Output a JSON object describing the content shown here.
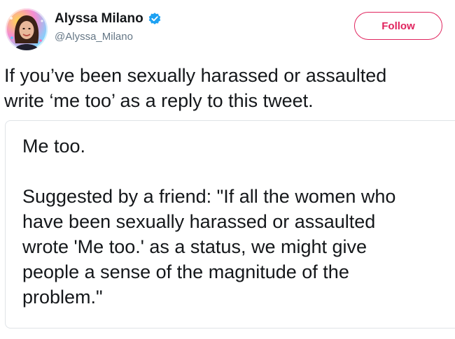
{
  "author": {
    "display_name": "Alyssa Milano",
    "handle": "@Alyssa_Milano",
    "verified_icon": "verified-badge-icon",
    "avatar": "profile-photo"
  },
  "follow_button": {
    "label": "Follow",
    "color": "#e0245e"
  },
  "tweet": {
    "text": "If you’ve been sexually harassed or assaulted\nwrite ‘me too’ as a reply to this tweet."
  },
  "quoted_image": {
    "line1": "Me too.",
    "body": "Suggested by a friend: \"If all the women who\nhave been sexually harassed or assaulted\nwrote 'Me too.' as a status, we might give\npeople a sense of the magnitude of the\nproblem.\""
  },
  "colors": {
    "accent": "#e0245e",
    "verified": "#1da1f2",
    "secondary_text": "#657786"
  }
}
